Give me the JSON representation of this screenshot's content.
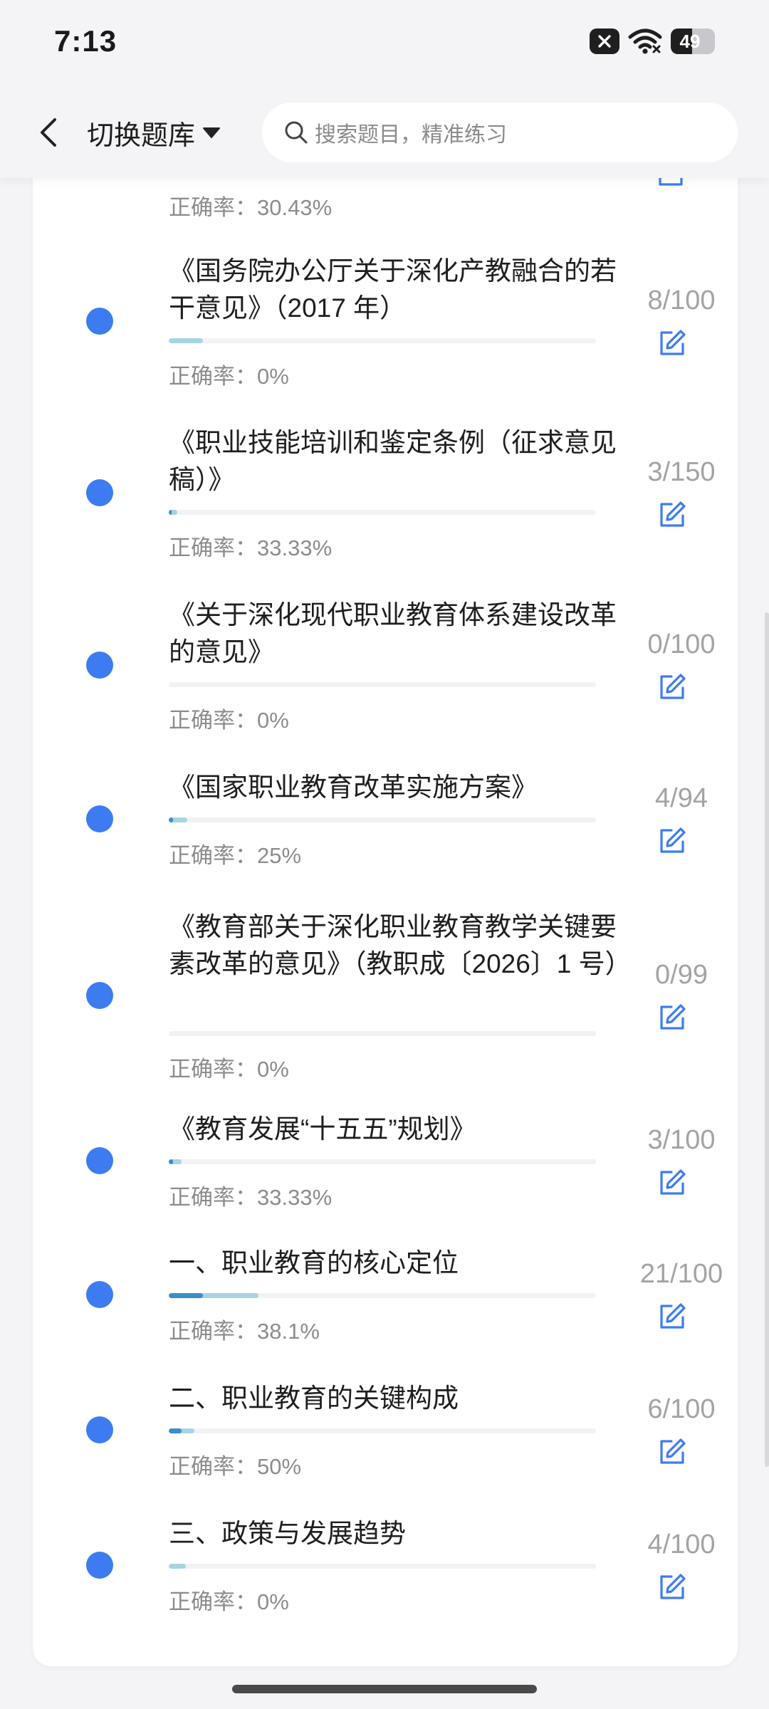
{
  "status_bar": {
    "time": "7:13",
    "battery": "49",
    "battery_level": 0.49
  },
  "header": {
    "switch_bank_label": "切换题库",
    "search_placeholder": "搜索题目，精准练习"
  },
  "partial_item": {
    "accuracy": "正确率：30.43%"
  },
  "colors": {
    "accent_blue": "#3d7cf0",
    "progress_track": "#f1f2f4",
    "progress_fill": "#a8d4e2",
    "progress_accent": "#3b8ec8",
    "muted_text": "#8c8c8c"
  },
  "items": [
    {
      "title": "《国务院办公厅关于深化产教融合的若干意见》（2017 年）",
      "count": "8/100",
      "accuracy": "正确率：0%",
      "progress": 0.08,
      "accuracy_value": 0
    },
    {
      "title": "《职业技能培训和鉴定条例（征求意见稿）》",
      "count": "3/150",
      "accuracy": "正确率：33.33%",
      "progress": 0.02,
      "accuracy_value": 0.3333
    },
    {
      "title": "《关于深化现代职业教育体系建设改革的意见》",
      "count": "0/100",
      "accuracy": "正确率：0%",
      "progress": 0.0,
      "accuracy_value": 0
    },
    {
      "title": "《国家职业教育改革实施方案》",
      "count": "4/94",
      "accuracy": "正确率：25%",
      "progress": 0.0426,
      "accuracy_value": 0.25
    },
    {
      "title": "《教育部关于深化职业教育教学关键要素改革的意见》（教职成〔2026〕1 号）",
      "count": "0/99",
      "accuracy": "正确率：0%",
      "progress": 0.0,
      "accuracy_value": 0
    },
    {
      "title": "《教育发展“十五五”规划》",
      "count": "3/100",
      "accuracy": "正确率：33.33%",
      "progress": 0.03,
      "accuracy_value": 0.3333
    },
    {
      "title": "一、职业教育的核心定位",
      "count": "21/100",
      "accuracy": "正确率：38.1%",
      "progress": 0.21,
      "accuracy_value": 0.381
    },
    {
      "title": "二、职业教育的关键构成",
      "count": "6/100",
      "accuracy": "正确率：50%",
      "progress": 0.06,
      "accuracy_value": 0.5
    },
    {
      "title": "三、政策与发展趋势",
      "count": "4/100",
      "accuracy": "正确率：0%",
      "progress": 0.04,
      "accuracy_value": 0
    }
  ]
}
